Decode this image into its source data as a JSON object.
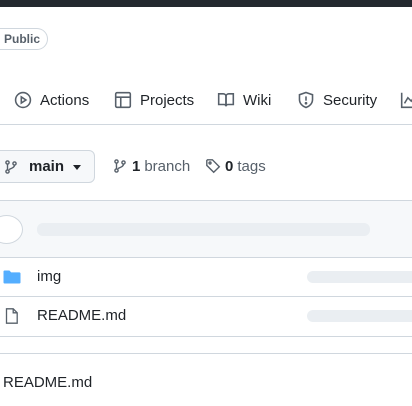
{
  "header": {
    "visibility_badge": "Public"
  },
  "nav": {
    "tabs": [
      {
        "label": "Actions",
        "icon": "play-circle-icon"
      },
      {
        "label": "Projects",
        "icon": "table-icon"
      },
      {
        "label": "Wiki",
        "icon": "book-icon"
      },
      {
        "label": "Security",
        "icon": "shield-icon"
      },
      {
        "label": "",
        "icon": "graph-icon"
      }
    ]
  },
  "repo": {
    "branch_selector": {
      "label": "main",
      "icon": "git-branch-icon"
    },
    "branches": {
      "count": "1",
      "label": "branch"
    },
    "tags": {
      "count": "0",
      "label": "tags"
    }
  },
  "files": [
    {
      "name": "img",
      "type": "folder",
      "icon": "folder-icon"
    },
    {
      "name": "README.md",
      "type": "file",
      "icon": "file-icon"
    }
  ],
  "readme": {
    "title": "README.md"
  },
  "colors": {
    "folder": "#54aeff",
    "border": "#d0d7de",
    "muted": "#57606a",
    "topbar": "#24292f"
  }
}
